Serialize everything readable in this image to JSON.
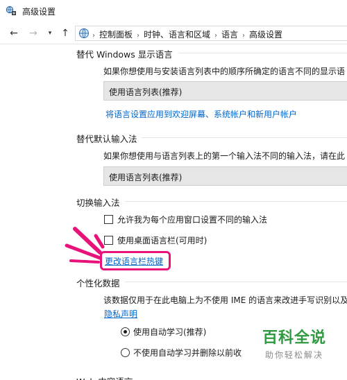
{
  "window": {
    "title": "高级设置",
    "icon": "language-settings-icon"
  },
  "nav": {
    "back_icon": "arrow-left-icon",
    "forward_icon": "arrow-right-icon",
    "recent_icon": "chevron-down-icon",
    "up_icon": "arrow-up-icon"
  },
  "breadcrumb": {
    "icon": "control-panel-icon",
    "items": [
      "控制面板",
      "时钟、语言和区域",
      "语言",
      "高级设置"
    ]
  },
  "display_language": {
    "header": "替代 Windows 显示语言",
    "description": "如果你想使用与安装语言列表中的顺序所确定的语言不同的显示语",
    "dropdown_value": "使用语言列表(推荐)",
    "link": "将语言设置应用到欢迎屏幕、系统帐户和新用户帐户"
  },
  "input_method": {
    "header": "替代默认输入法",
    "description": "如果你想使用与语言列表上的第一个输入法不同的输入法，请在此",
    "dropdown_value": "使用语言列表(推荐)"
  },
  "switch_input": {
    "header": "切换输入法",
    "option1": "允许我为每个应用窗口设置不同的输入法",
    "option2": "使用桌面语言栏(可用时)",
    "hotkey_link": "更改语言栏热键"
  },
  "personalization": {
    "header": "个性化数据",
    "description": "该数据仅用于在此电脑上为不使用 IME 的语言来改进手写识别以及",
    "privacy_link": "隐私声明",
    "radio1": "使用自动学习(推荐)",
    "radio2": "不使用自动学习并删除以前收"
  },
  "next_section_partial": "Web 内容语言",
  "watermark": {
    "title": "百科全说",
    "subtitle": "助你轻松解决"
  },
  "colors": {
    "link": "#0066cc",
    "highlight": "#e8137a",
    "watermark": "#2f9b40"
  }
}
